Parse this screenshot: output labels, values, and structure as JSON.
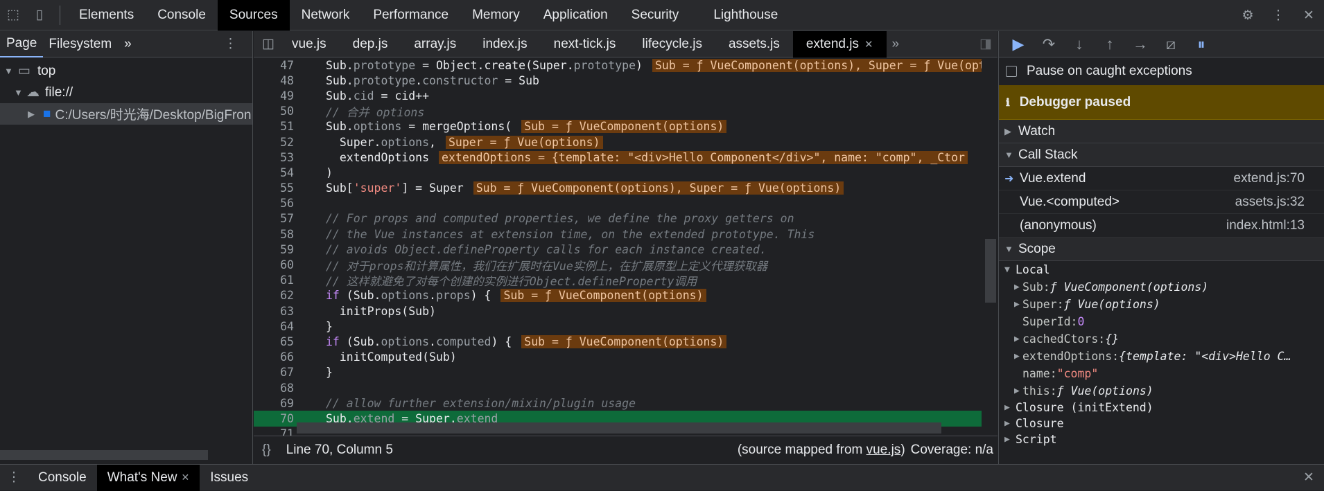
{
  "toolbar": {
    "tabs": [
      "Elements",
      "Console",
      "Sources",
      "Network",
      "Performance",
      "Memory",
      "Application",
      "Security",
      "Lighthouse"
    ],
    "active": "Sources"
  },
  "navigator": {
    "tabs": [
      "Page",
      "Filesystem"
    ],
    "more": "»",
    "tree": [
      {
        "label": "top"
      },
      {
        "label": "file://"
      },
      {
        "label": "C:/Users/时光海/Desktop/BigFron"
      }
    ]
  },
  "editor": {
    "tabs": [
      "vue.js",
      "dep.js",
      "array.js",
      "index.js",
      "next-tick.js",
      "lifecycle.js",
      "assets.js",
      "extend.js"
    ],
    "active": "extend.js",
    "status": {
      "position": "Line 70, Column 5",
      "mapped_prefix": "(source mapped from ",
      "mapped_file": "vue.js",
      "mapped_suffix": ")",
      "coverage": "Coverage: n/a"
    }
  },
  "code_lines": [
    {
      "n": "47",
      "t": "Sub.prototype = Object.create(Super.prototype)",
      "i": "Sub = ƒ VueComponent(options), Super = ƒ Vue(options)"
    },
    {
      "n": "48",
      "t": "Sub.prototype.constructor = Sub",
      "i": ""
    },
    {
      "n": "49",
      "t": "Sub.cid = cid++",
      "i": ""
    },
    {
      "n": "50",
      "t": "// 合并 options",
      "i": "",
      "c": true
    },
    {
      "n": "51",
      "t": "Sub.options = mergeOptions(",
      "i": "Sub = ƒ VueComponent(options)"
    },
    {
      "n": "52",
      "t": "  Super.options,",
      "i": "Super = ƒ Vue(options)"
    },
    {
      "n": "53",
      "t": "  extendOptions",
      "i": "extendOptions = {template: \"<div>Hello Component</div>\", name: \"comp\", _Ctor"
    },
    {
      "n": "54",
      "t": ")",
      "i": ""
    },
    {
      "n": "55",
      "t": "Sub['super'] = Super",
      "i": "Sub = ƒ VueComponent(options), Super = ƒ Vue(options)"
    },
    {
      "n": "56",
      "t": "",
      "i": ""
    },
    {
      "n": "57",
      "t": "// For props and computed properties, we define the proxy getters on",
      "i": "",
      "c": true
    },
    {
      "n": "58",
      "t": "// the Vue instances at extension time, on the extended prototype. This",
      "i": "",
      "c": true
    },
    {
      "n": "59",
      "t": "// avoids Object.defineProperty calls for each instance created.",
      "i": "",
      "c": true
    },
    {
      "n": "60",
      "t": "// 对于props和计算属性，我们在扩展时在Vue实例上，在扩展原型上定义代理获取器",
      "i": "",
      "c": true
    },
    {
      "n": "61",
      "t": "// 这样就避免了对每个创建的实例进行Object.defineProperty调用",
      "i": "",
      "c": true
    },
    {
      "n": "62",
      "t": "if (Sub.options.props) {",
      "i": "Sub = ƒ VueComponent(options)"
    },
    {
      "n": "63",
      "t": "  initProps(Sub)",
      "i": ""
    },
    {
      "n": "64",
      "t": "}",
      "i": ""
    },
    {
      "n": "65",
      "t": "if (Sub.options.computed) {",
      "i": "Sub = ƒ VueComponent(options)"
    },
    {
      "n": "66",
      "t": "  initComputed(Sub)",
      "i": ""
    },
    {
      "n": "67",
      "t": "}",
      "i": ""
    },
    {
      "n": "68",
      "t": "",
      "i": ""
    },
    {
      "n": "69",
      "t": "// allow further extension/mixin/plugin usage",
      "i": "",
      "c": true
    },
    {
      "n": "70",
      "t": "Sub.extend = Super.extend",
      "i": "",
      "cur": true
    },
    {
      "n": "71",
      "t": "",
      "i": ""
    }
  ],
  "debugger": {
    "pause_exceptions": "Pause on caught exceptions",
    "banner": "Debugger paused",
    "watch": "Watch",
    "callstack": "Call Stack",
    "frames": [
      {
        "fn": "Vue.extend",
        "loc": "extend.js:70"
      },
      {
        "fn": "Vue.<computed>",
        "loc": "assets.js:32"
      },
      {
        "fn": "(anonymous)",
        "loc": "index.html:13"
      }
    ],
    "scope": "Scope",
    "local": "Local",
    "vars": [
      {
        "k": "Sub: ",
        "v": "ƒ VueComponent(options)",
        "a": true
      },
      {
        "k": "Super: ",
        "v": "ƒ Vue(options)",
        "a": true
      },
      {
        "k": "SuperId: ",
        "v": "0",
        "a": false,
        "num": true
      },
      {
        "k": "cachedCtors: ",
        "v": "{}",
        "a": true
      },
      {
        "k": "extendOptions: ",
        "v": "{template: \"<div>Hello C…",
        "a": true
      },
      {
        "k": "name: ",
        "v": "\"comp\"",
        "a": false,
        "str": true
      },
      {
        "k": "this: ",
        "v": "ƒ Vue(options)",
        "a": true
      }
    ],
    "closures": [
      "Closure (initExtend)",
      "Closure",
      "Script"
    ]
  },
  "drawer": {
    "tabs": [
      "Console",
      "What's New",
      "Issues"
    ],
    "active": "What's New"
  }
}
